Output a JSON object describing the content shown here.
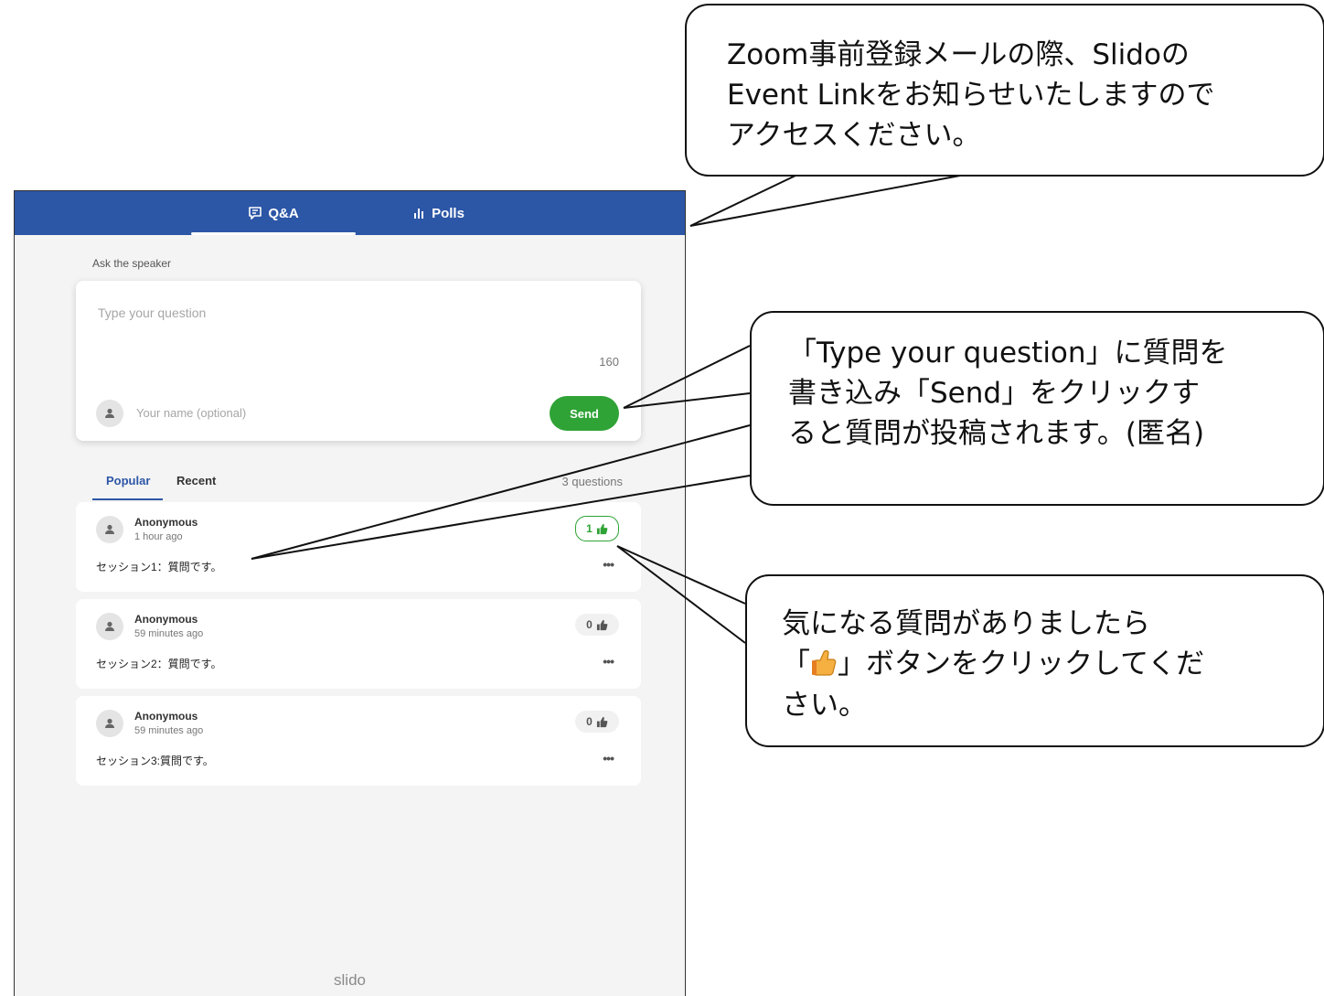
{
  "tabs": {
    "qa_label": "Q&A",
    "polls_label": "Polls"
  },
  "ask": {
    "label": "Ask the speaker",
    "question_placeholder": "Type your question",
    "char_counter": "160",
    "name_placeholder": "Your name (optional)",
    "send_label": "Send"
  },
  "list": {
    "tab_popular": "Popular",
    "tab_recent": "Recent",
    "count_text": "3 questions"
  },
  "questions": [
    {
      "author": "Anonymous",
      "time": "1 hour ago",
      "text": "セッション1：質問です。",
      "likes": "1",
      "liked": true
    },
    {
      "author": "Anonymous",
      "time": "59 minutes ago",
      "text": "セッション2：質問です。",
      "likes": "0",
      "liked": false
    },
    {
      "author": "Anonymous",
      "time": "59 minutes ago",
      "text": "セッション3:質問です。",
      "likes": "0",
      "liked": false
    }
  ],
  "more_label": "•••",
  "brand": "slido",
  "callouts": {
    "top": [
      "Zoom事前登録メールの際、Slidoの",
      "Event Linkをお知らせいたしますので",
      "アクセスください。"
    ],
    "middle": [
      "「Type your question」に質問を",
      "書き込み「Send」をクリックす",
      "ると質問が投稿されます。(匿名)"
    ],
    "bottom_line1": "気になる質問がありましたら",
    "bottom_line2_prefix": "「",
    "bottom_line2_suffix": "」ボタンをクリックしてくだ",
    "bottom_line3": "さい。"
  },
  "icons": {
    "qa_tab": "chat-bubble-icon",
    "polls_tab": "bar-chart-icon",
    "avatar": "user-icon",
    "like": "thumbs-up-icon",
    "callout_thumb": "thumbs-up-emoji"
  },
  "colors": {
    "header": "#2c56a6",
    "send": "#2fa335",
    "liked": "#2fa335",
    "background": "#f4f4f4"
  }
}
